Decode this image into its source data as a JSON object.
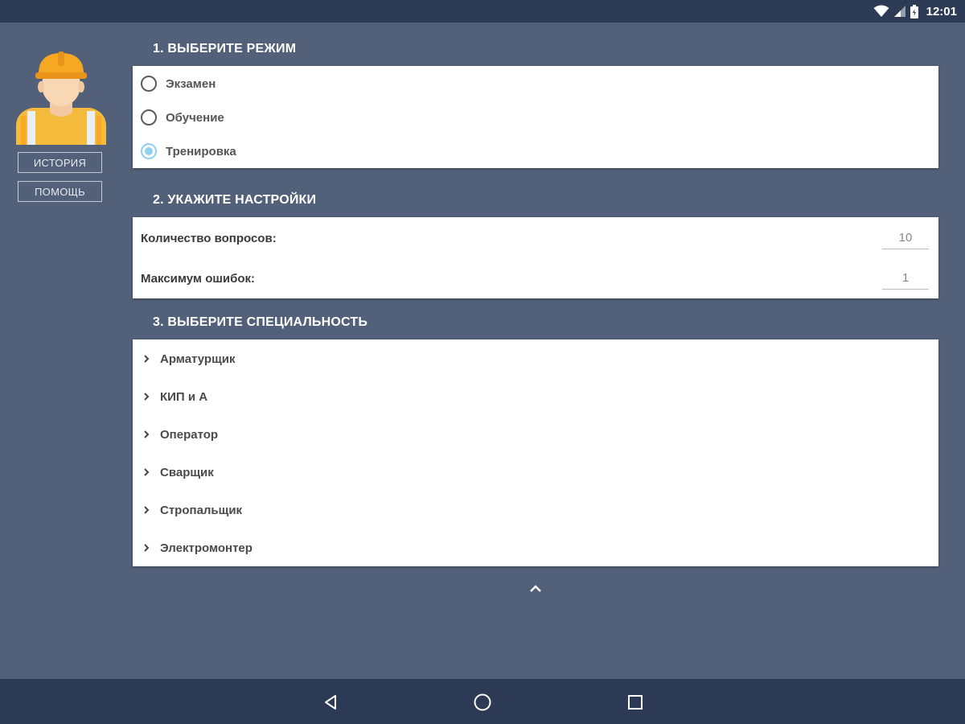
{
  "status_bar": {
    "time": "12:01",
    "icons": [
      "wifi-icon",
      "signal-icon",
      "battery-icon"
    ]
  },
  "sidebar": {
    "avatar": "worker-avatar-icon",
    "buttons": [
      {
        "label": "ИСТОРИЯ"
      },
      {
        "label": "ПОМОЩЬ"
      }
    ]
  },
  "mode": {
    "title": "1. ВЫБЕРИТЕ РЕЖИМ",
    "options": [
      {
        "label": "Экзамен",
        "checked": false
      },
      {
        "label": "Обучение",
        "checked": false
      },
      {
        "label": "Тренировка",
        "checked": true
      }
    ]
  },
  "settings": {
    "title": "2. УКАЖИТЕ НАСТРОЙКИ",
    "questions_label": "Количество вопросов:",
    "questions_value": "10",
    "mistakes_label": "Максимум ошибок:",
    "mistakes_value": "1"
  },
  "specialty": {
    "title": "3. ВЫБЕРИТЕ СПЕЦИАЛЬНОСТЬ",
    "items": [
      {
        "label": "Арматурщик"
      },
      {
        "label": "КИП и А"
      },
      {
        "label": "Оператор"
      },
      {
        "label": "Сварщик"
      },
      {
        "label": "Стропальщик"
      },
      {
        "label": "Электромонтер"
      }
    ],
    "collapse_icon": "chevron-up-icon"
  },
  "colors": {
    "background": "#536079",
    "bars": "#2d3a55",
    "radio_accent": "#8fd1ef",
    "helmet": "#f7a823"
  },
  "nav_bar": {
    "icons": [
      "back-icon",
      "home-icon",
      "recents-icon"
    ]
  }
}
